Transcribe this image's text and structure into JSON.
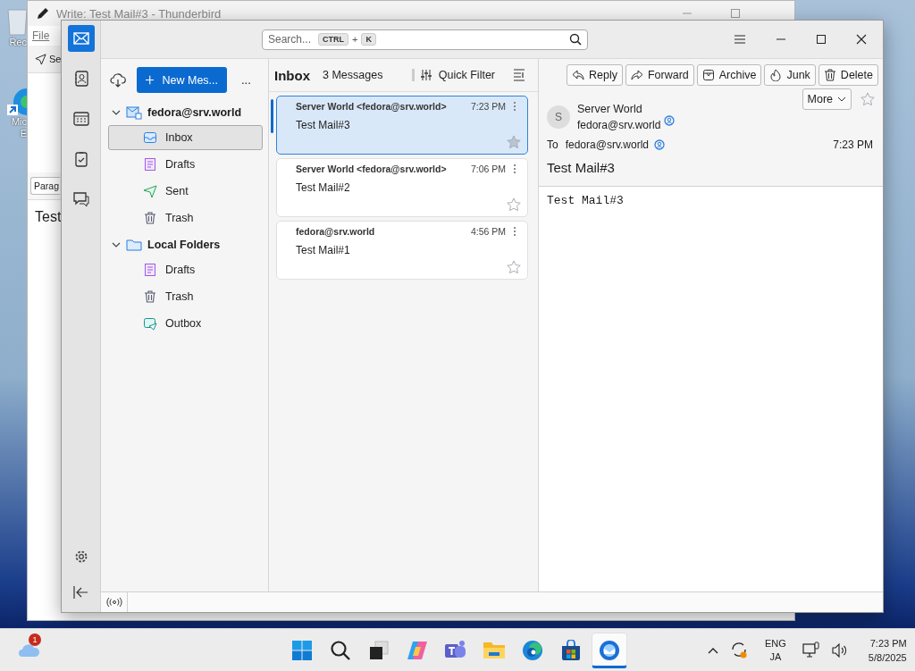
{
  "desktop": {
    "icons": [
      {
        "kind": "recycle-bin",
        "lines": [
          "Rec"
        ]
      },
      {
        "kind": "edge",
        "lines": [
          "Mic",
          "E"
        ]
      }
    ]
  },
  "back_window": {
    "title": "Write: Test Mail#3 - Thunderbird",
    "menu": "File",
    "send_button": "Se",
    "paragraph_select": "Parag",
    "body": "Test"
  },
  "spaces": [
    {
      "kind": "mail",
      "selected": true
    },
    {
      "kind": "address-book",
      "selected": false
    },
    {
      "kind": "calendar",
      "selected": false
    },
    {
      "kind": "tasks",
      "selected": false
    },
    {
      "kind": "chat",
      "selected": false
    }
  ],
  "search": {
    "placeholder": "Search...",
    "keys": [
      "CTRL",
      "K"
    ],
    "plus": "+"
  },
  "folder_pane": {
    "new_message": "New Mes...",
    "more": "...",
    "accounts": [
      {
        "name": "fedora@srv.world",
        "kind": "mail",
        "expanded": true,
        "folders": [
          {
            "name": "Inbox",
            "kind": "inbox",
            "selected": true
          },
          {
            "name": "Drafts",
            "kind": "drafts",
            "selected": false
          },
          {
            "name": "Sent",
            "kind": "sent",
            "selected": false
          },
          {
            "name": "Trash",
            "kind": "trash",
            "selected": false
          }
        ]
      },
      {
        "name": "Local Folders",
        "kind": "local",
        "expanded": true,
        "folders": [
          {
            "name": "Drafts",
            "kind": "drafts",
            "selected": false
          },
          {
            "name": "Trash",
            "kind": "trash",
            "selected": false
          },
          {
            "name": "Outbox",
            "kind": "outbox",
            "selected": false
          }
        ]
      }
    ]
  },
  "message_list": {
    "folder": "Inbox",
    "count": "3 Messages",
    "quick_filter": "Quick Filter",
    "messages": [
      {
        "sender": "Server World",
        "address": "<fedora@srv.world>",
        "time": "7:23 PM",
        "subject": "Test Mail#3",
        "selected": true
      },
      {
        "sender": "Server World",
        "address": "<fedora@srv.world>",
        "time": "7:06 PM",
        "subject": "Test Mail#2",
        "selected": false
      },
      {
        "sender": "fedora@srv.world",
        "time": "4:56 PM",
        "subject": "Test Mail#1",
        "selected": false
      }
    ]
  },
  "reader": {
    "buttons": [
      {
        "kind": "reply",
        "label": "Reply"
      },
      {
        "kind": "forward",
        "label": "Forward"
      },
      {
        "kind": "archive",
        "label": "Archive"
      },
      {
        "kind": "junk",
        "label": "Junk"
      },
      {
        "kind": "delete",
        "label": "Delete"
      }
    ],
    "more": "More",
    "avatar": "S",
    "from_name": "Server World",
    "from_email": "fedora@srv.world",
    "to_label": "To",
    "to": "fedora@srv.world",
    "time": "7:23 PM",
    "subject": "Test Mail#3",
    "body": "Test Mail#3"
  },
  "taskbar": {
    "weather_badge": "1",
    "apps": [
      {
        "kind": "start",
        "selected": false
      },
      {
        "kind": "search",
        "selected": false
      },
      {
        "kind": "task-view",
        "selected": false
      },
      {
        "kind": "copilot",
        "selected": false
      },
      {
        "kind": "teams",
        "selected": false
      },
      {
        "kind": "explorer",
        "selected": false
      },
      {
        "kind": "edge",
        "selected": false
      },
      {
        "kind": "store",
        "selected": false
      },
      {
        "kind": "thunderbird",
        "selected": true
      }
    ],
    "lang": "ENG",
    "ime": "JA",
    "time": "7:23 PM",
    "date": "5/8/2025"
  }
}
